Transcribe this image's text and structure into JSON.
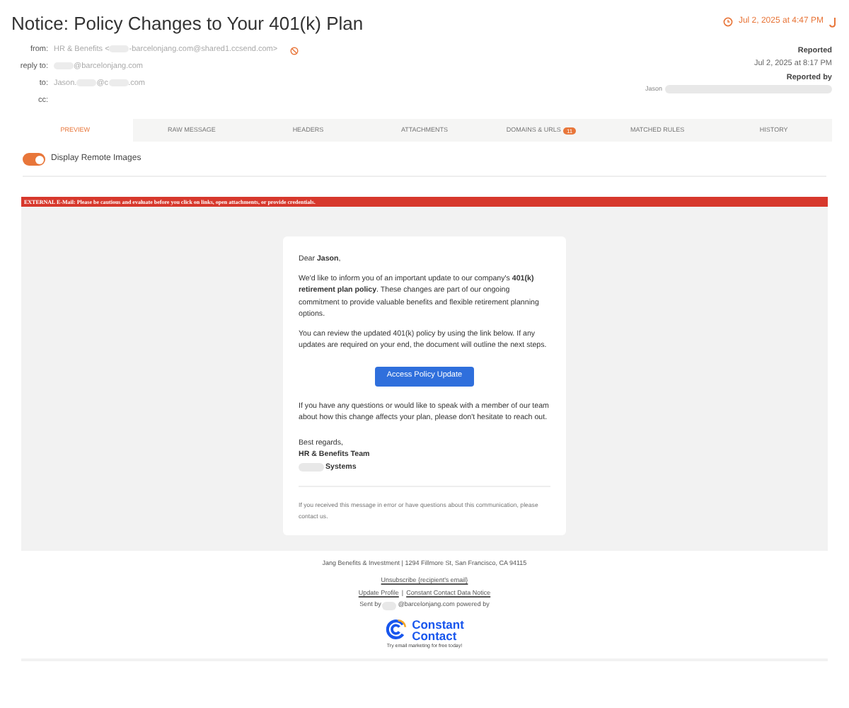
{
  "title": "Notice: Policy Changes to Your 401(k) Plan",
  "received": "Jul 2, 2025 at 4:47 PM",
  "fields": [
    {
      "label": "from:",
      "parts": [
        {
          "kind": "text",
          "text": "HR & Benefits <"
        },
        {
          "kind": "redacted"
        },
        {
          "kind": "text",
          "text": "-barcelonjang.com@shared1.ccsend.com>"
        }
      ],
      "blocked": true
    },
    {
      "label": "reply to:",
      "parts": [
        {
          "kind": "redacted"
        },
        {
          "kind": "text",
          "text": "@barcelonjang.com"
        }
      ],
      "blocked": false
    },
    {
      "label": "to:",
      "parts": [
        {
          "kind": "text",
          "text": "Jason."
        },
        {
          "kind": "redacted"
        },
        {
          "kind": "text",
          "text": "@c"
        },
        {
          "kind": "redacted"
        },
        {
          "kind": "text",
          "text": ".com"
        }
      ],
      "blocked": false
    },
    {
      "label": "cc:",
      "blocked": false
    }
  ],
  "report": {
    "reported_label": "Reported",
    "reported_time": "Jul 2, 2025 at 8:17 PM",
    "reported_by_label": "Reported by",
    "reporter": "Jason"
  },
  "tabs": [
    {
      "label": "PREVIEW",
      "selected": true
    },
    {
      "label": "RAW MESSAGE",
      "selected": false
    },
    {
      "label": "HEADERS",
      "selected": false
    },
    {
      "label": "ATTACHMENTS",
      "selected": false
    },
    {
      "label": "DOMAINS & URLS",
      "selected": false,
      "badge": "11"
    },
    {
      "label": "MATCHED RULES",
      "selected": false
    },
    {
      "label": "HISTORY",
      "selected": false
    }
  ],
  "remote_images": {
    "label": "Display Remote Images",
    "on": true
  },
  "banner": "EXTERNAL E-Mail: Please be cautious and evaluate before you click on links, open attachments, or provide credentials.",
  "email": {
    "greeting": "Dear **Jason**,",
    "paragraphs": [
      "We'd like to inform you of an important update to our company's **401(k) retirement plan policy**. These changes are part of our ongoing commitment to provide valuable benefits and flexible retirement planning options.",
      "You can review the updated 401(k) policy by using the link below. If any updates are required on your end, the document will outline the next steps."
    ],
    "button": "Access Policy Update",
    "closing_paragraph": "If you have any questions or would like to speak with a member of our team about how this change affects your plan, please don't hesitate to reach out.",
    "signoff": "Best regards,",
    "team": "HR & Benefits Team",
    "company": "Systems",
    "notice": "If you received this message in error or have questions about this communication, please contact us."
  },
  "footer": {
    "address": "Jang Benefits & Investment | 1294 Fillmore St, San Francisco, CA 94115",
    "unsubscribe": "Unsubscribe {recipient's email}",
    "links": [
      "Update Profile",
      "Constant Contact Data Notice"
    ],
    "link_separator": "|",
    "sent_by_prefix": "Sent by",
    "sent_by_suffix": "@barcelonjang.com powered by",
    "logo_line_1": "Constant",
    "logo_line_2": "Contact",
    "logo_tagline": "Try email marketing for free today!"
  }
}
